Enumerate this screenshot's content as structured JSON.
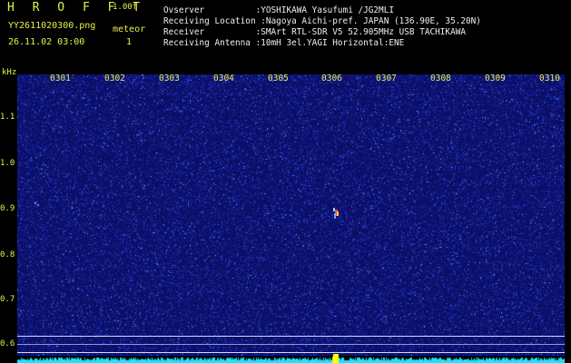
{
  "header": {
    "app_title": "H R O F F T",
    "version": "1.00f",
    "filename": "YY2611020300.png",
    "meteor_label": "meteor",
    "datetime": "26.11.02 03:00",
    "meteor_count": "1",
    "info_lines": [
      "Ovserver          :YOSHIKAWA Yasufumi /JG2MLI",
      "Receiving Location :Nagoya Aichi-pref. JAPAN (136.90E, 35.20N)",
      "Receiver          :SMArt RTL-SDR V5 52.905MHz USB TACHIKAWA",
      "Receiving Antenna :10mH 3el.YAGI Horizontal:ENE"
    ]
  },
  "axis": {
    "unit": "kHz",
    "y_ticks": [
      "1.1",
      "1.0",
      "0.9",
      "0.8",
      "0.7",
      "0.6"
    ],
    "x_ticks": [
      "0301",
      "0302",
      "0303",
      "0304",
      "0305",
      "0306",
      "0307",
      "0308",
      "0309",
      "0310"
    ]
  },
  "colors": {
    "background": "#0c0f68",
    "label": "#e6f04a",
    "noise": "#1ee0ff",
    "marker": "#ffff00"
  }
}
